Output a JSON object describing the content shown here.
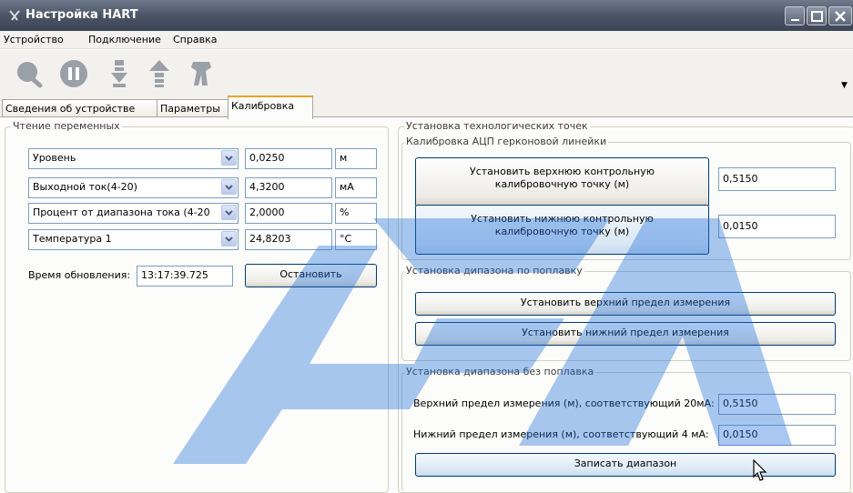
{
  "window": {
    "title": "Настройка HART"
  },
  "menu": [
    "Устройство",
    "Подключение",
    "Справка"
  ],
  "toolbar": {
    "icons": [
      "search-icon",
      "pause-icon",
      "download-icon",
      "upload-icon",
      "tool-icon"
    ]
  },
  "tabs": [
    {
      "label": "Сведения об устройстве",
      "active": false
    },
    {
      "label": "Параметры",
      "active": false
    },
    {
      "label": "Калибровка",
      "active": true
    }
  ],
  "reading": {
    "title": "Чтение переменных",
    "rows": [
      {
        "variable": "Уровень",
        "value": "0,0250",
        "unit": "м"
      },
      {
        "variable": "Выходной ток(4-20)",
        "value": "4,3200",
        "unit": "мА"
      },
      {
        "variable": "Процент от диапазона тока (4-20",
        "value": "2,0000",
        "unit": "%"
      },
      {
        "variable": "Температура 1",
        "value": "24,8203",
        "unit": "°C"
      }
    ],
    "update_time_label": "Время обновления:",
    "update_time_value": "13:17:39.725",
    "stop_button": "Остановить"
  },
  "tech_points": {
    "title": "Установка технологических точек",
    "adc": {
      "title": "Калибровка АЦП герконовой линейки",
      "upper_button_line1": "Установить верхнюю контрольную",
      "upper_button_line2": "калибровочную точку (м)",
      "upper_value": "0,5150",
      "lower_button_line1": "Установить нижнюю контрольную",
      "lower_button_line2": "калибровочную точку (м)",
      "lower_value": "0,0150"
    },
    "float_range": {
      "title": "Установка дипазона по поплавку",
      "upper_button": "Установить верхний предел измерения",
      "lower_button": "Установить нижний предел измерения"
    },
    "no_float_range": {
      "title": "Установка диапазона без поплавка",
      "upper_label": "Верхний предел измерения (м), соответствующий 20мА:",
      "upper_value": "0,5150",
      "lower_label": "Нижний предел измерения (м), соответствующий 4 мА:",
      "lower_value": "0,0150",
      "write_button": "Записать диапазон"
    }
  },
  "colors": {
    "accent_tab": "#e8a32c",
    "watermark": "#1e6fd9",
    "titlebar": "#4b5566"
  }
}
